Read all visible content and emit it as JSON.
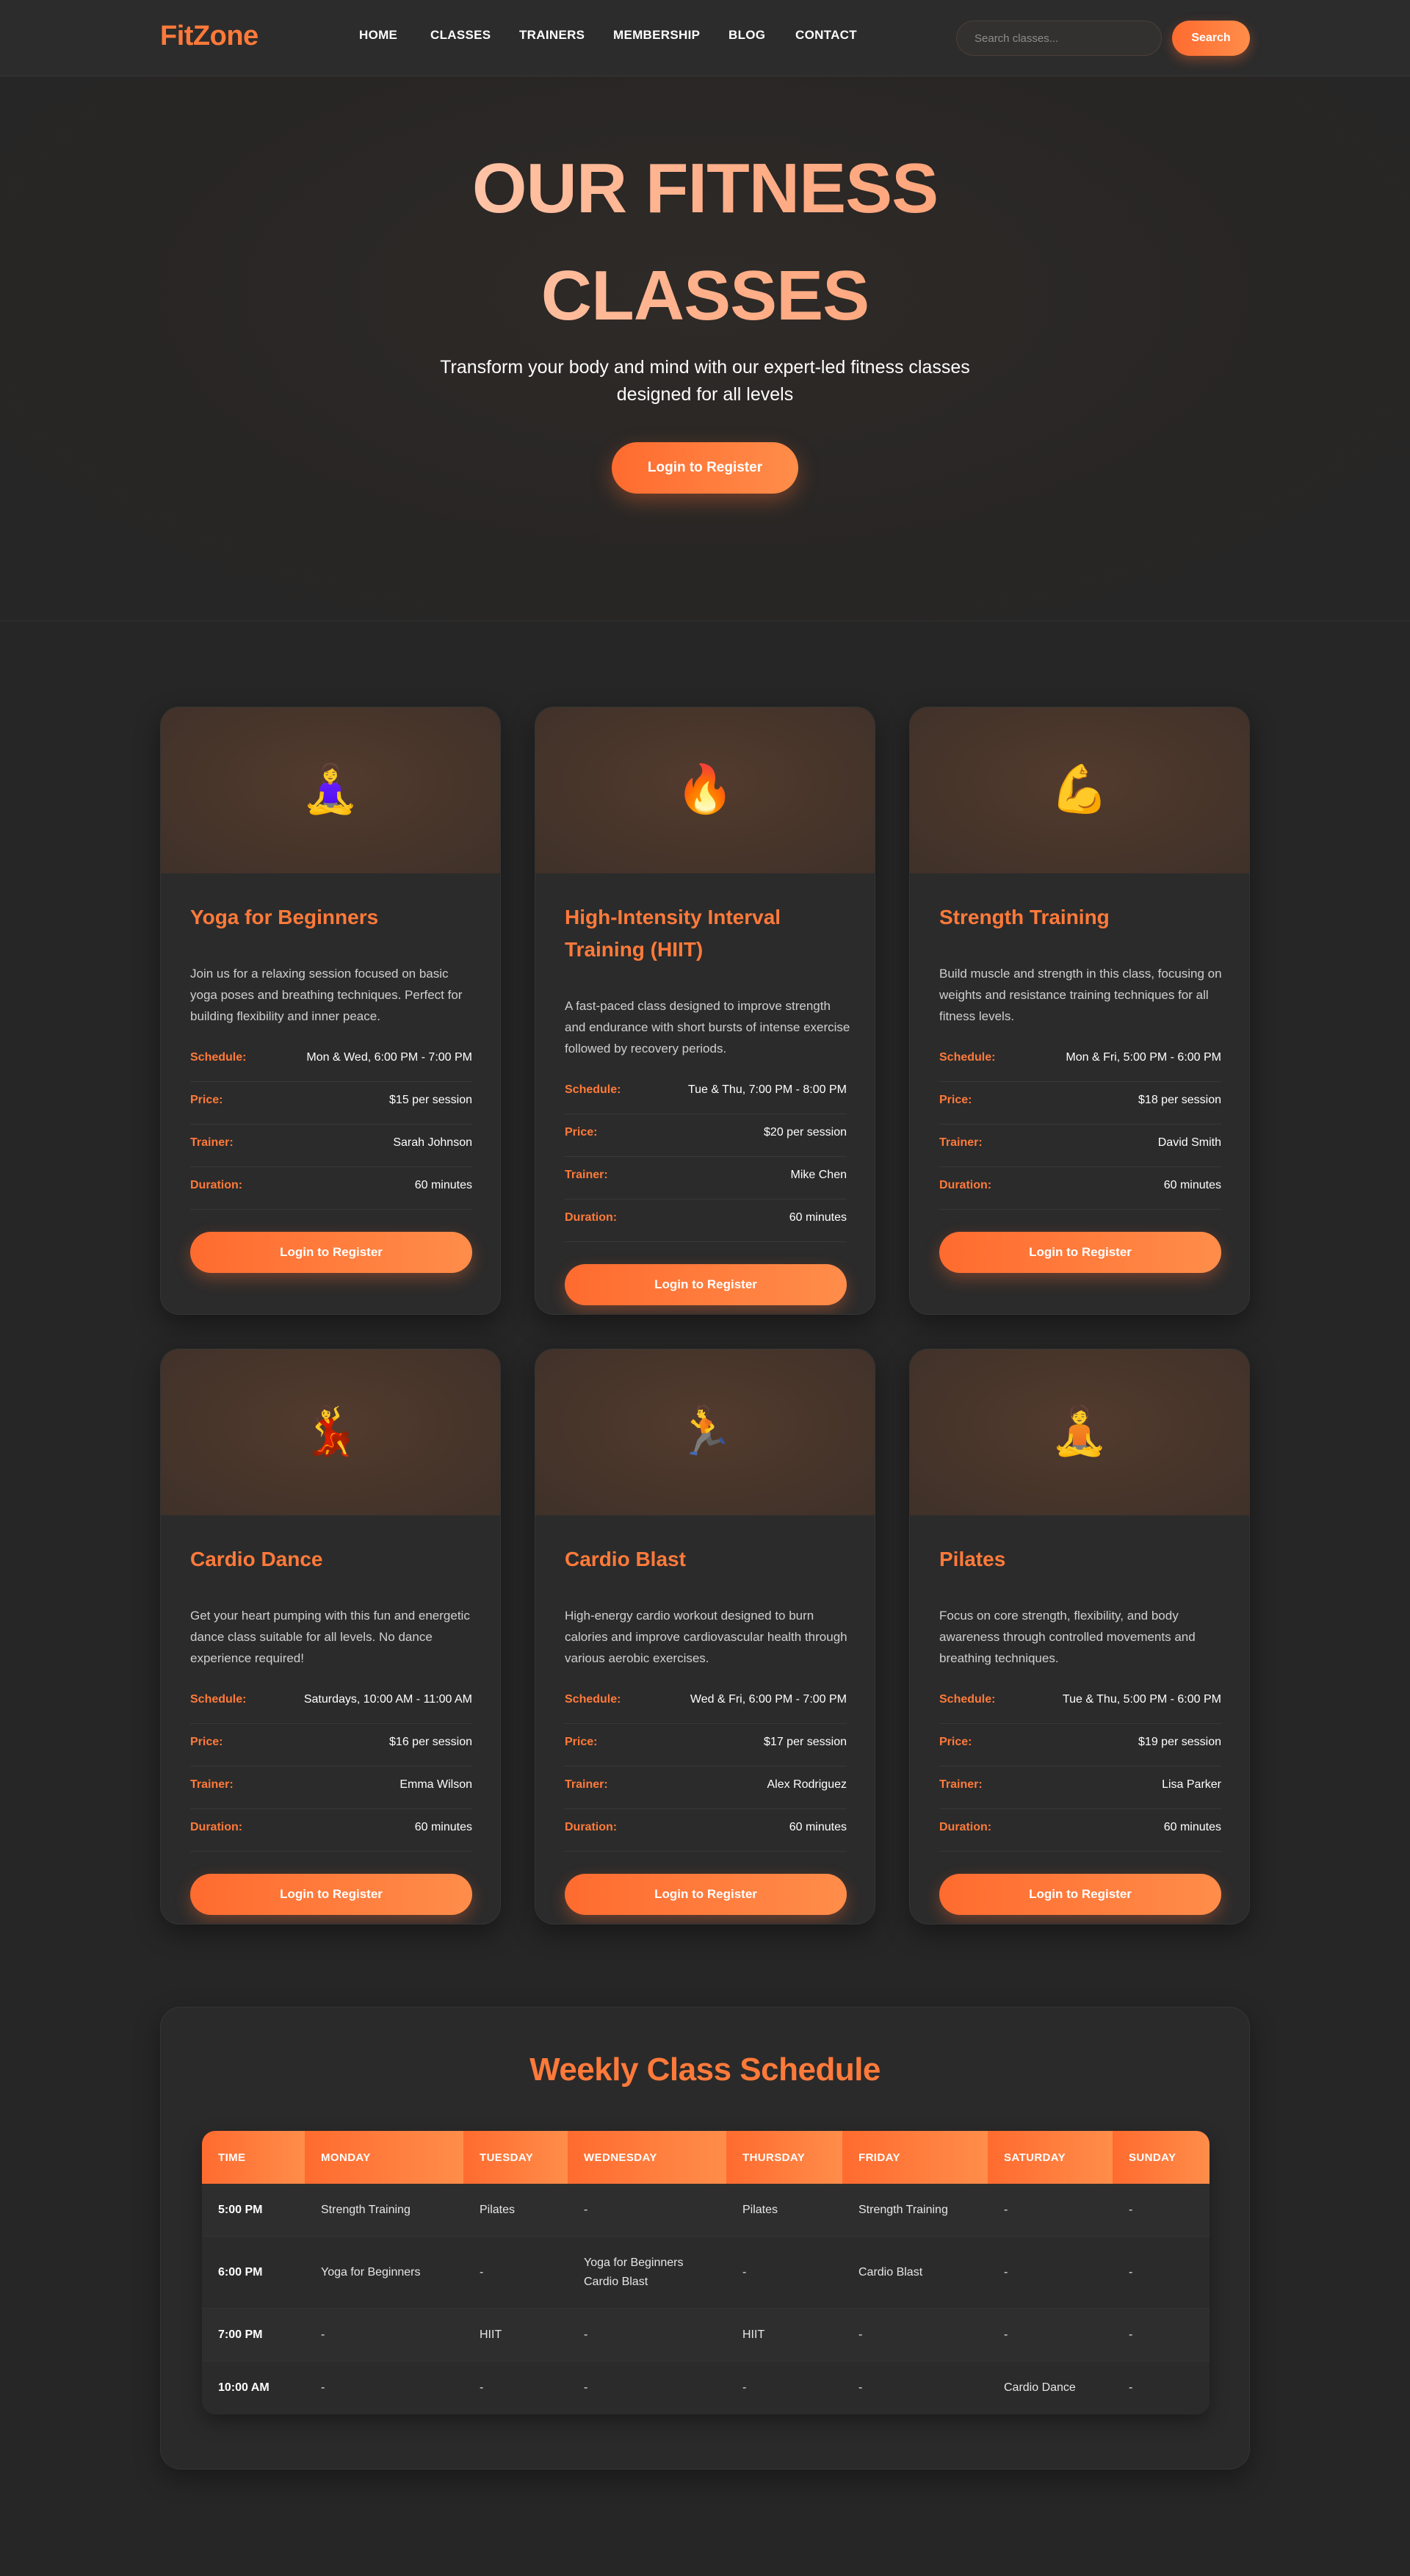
{
  "nav": {
    "logo": "FitZone",
    "links": [
      "HOME",
      "CLASSES",
      "TRAINERS",
      "MEMBERSHIP",
      "BLOG",
      "CONTACT"
    ],
    "search_placeholder": "Search classes...",
    "search_button": "Search"
  },
  "hero": {
    "title_line1": "OUR FITNESS",
    "title_line2": "CLASSES",
    "subtitle": "Transform your body and mind with our expert-led fitness classes designed for all levels",
    "button": "Login to Register"
  },
  "labels": {
    "schedule": "Schedule:",
    "price": "Price:",
    "trainer": "Trainer:",
    "duration": "Duration:"
  },
  "classes": [
    {
      "icon": "🧘‍♀️",
      "icon_name": "yoga-icon",
      "title": "Yoga for Beginners",
      "description": "Join us for a relaxing session focused on basic yoga poses and breathing techniques. Perfect for building flexibility and inner peace.",
      "schedule": "Mon & Wed, 6:00 PM - 7:00 PM",
      "price": "$15 per session",
      "trainer": "Sarah Johnson",
      "duration": "60 minutes",
      "button": "Login to Register"
    },
    {
      "icon": "🔥",
      "icon_name": "fire-icon",
      "title": "High-Intensity Interval Training (HIIT)",
      "description": "A fast-paced class designed to improve strength and endurance with short bursts of intense exercise followed by recovery periods.",
      "schedule": "Tue & Thu, 7:00 PM - 8:00 PM",
      "price": "$20 per session",
      "trainer": "Mike Chen",
      "duration": "60 minutes",
      "button": "Login to Register"
    },
    {
      "icon": "💪",
      "icon_name": "flexed-biceps-icon",
      "title": "Strength Training",
      "description": "Build muscle and strength in this class, focusing on weights and resistance training techniques for all fitness levels.",
      "schedule": "Mon & Fri, 5:00 PM - 6:00 PM",
      "price": "$18 per session",
      "trainer": "David Smith",
      "duration": "60 minutes",
      "button": "Login to Register"
    },
    {
      "icon": "💃",
      "icon_name": "dancer-icon",
      "title": "Cardio Dance",
      "description": "Get your heart pumping with this fun and energetic dance class suitable for all levels. No dance experience required!",
      "schedule": "Saturdays, 10:00 AM - 11:00 AM",
      "price": "$16 per session",
      "trainer": "Emma Wilson",
      "duration": "60 minutes",
      "button": "Login to Register"
    },
    {
      "icon": "🏃",
      "icon_name": "runner-icon",
      "title": "Cardio Blast",
      "description": "High-energy cardio workout designed to burn calories and improve cardiovascular health through various aerobic exercises.",
      "schedule": "Wed & Fri, 6:00 PM - 7:00 PM",
      "price": "$17 per session",
      "trainer": "Alex Rodriguez",
      "duration": "60 minutes",
      "button": "Login to Register"
    },
    {
      "icon": "🧘",
      "icon_name": "meditation-icon",
      "title": "Pilates",
      "description": "Focus on core strength, flexibility, and body awareness through controlled movements and breathing techniques.",
      "schedule": "Tue & Thu, 5:00 PM - 6:00 PM",
      "price": "$19 per session",
      "trainer": "Lisa Parker",
      "duration": "60 minutes",
      "button": "Login to Register"
    }
  ],
  "schedule": {
    "title": "Weekly Class Schedule",
    "headers": [
      "TIME",
      "MONDAY",
      "TUESDAY",
      "WEDNESDAY",
      "THURSDAY",
      "FRIDAY",
      "SATURDAY",
      "SUNDAY"
    ],
    "rows": [
      [
        "5:00 PM",
        "Strength Training",
        "Pilates",
        "-",
        "Pilates",
        "Strength Training",
        "-",
        "-"
      ],
      [
        "6:00 PM",
        "Yoga for Beginners",
        "-",
        "Yoga for Beginners\nCardio Blast",
        "-",
        "Cardio Blast",
        "-",
        "-"
      ],
      [
        "7:00 PM",
        "-",
        "HIIT",
        "-",
        "HIIT",
        "-",
        "-",
        "-"
      ],
      [
        "10:00 AM",
        "-",
        "-",
        "-",
        "-",
        "-",
        "Cardio Dance",
        "-"
      ]
    ]
  }
}
